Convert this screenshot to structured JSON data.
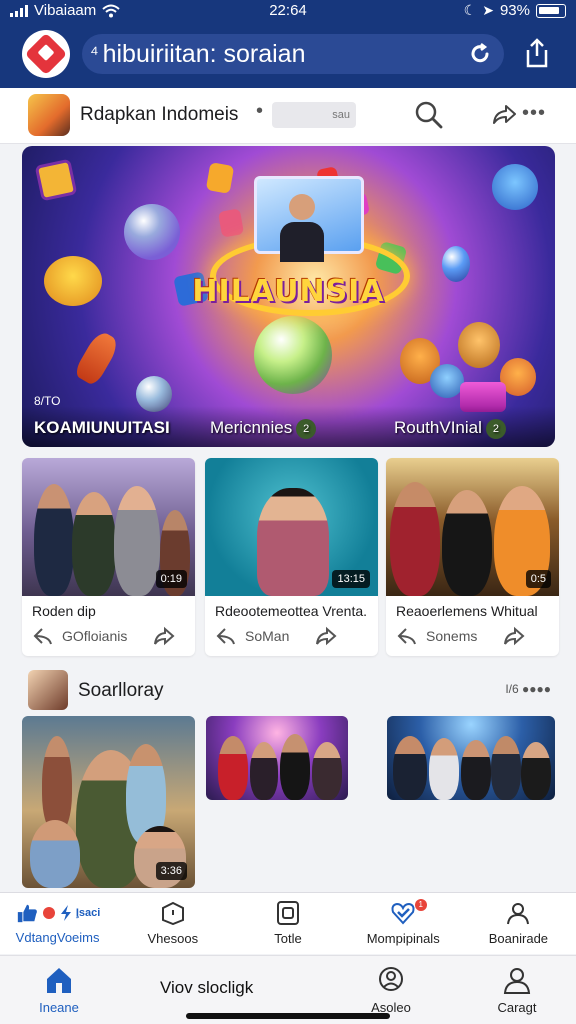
{
  "status_bar": {
    "carrier": "Vibaiaam",
    "time": "22:64",
    "battery": "93%"
  },
  "header": {
    "search_text": "hibuiriitan: soraian"
  },
  "account": {
    "name": "Rdapkan Indomeis",
    "pill": "sau"
  },
  "hero": {
    "title": "HILAUNSIA",
    "retro": "8/TO",
    "labels": [
      {
        "text": "KOAMIUNUITASI",
        "badge": ""
      },
      {
        "text": "Mericnnies",
        "badge": "2"
      },
      {
        "text": "RouthVInial",
        "badge": "2"
      }
    ]
  },
  "cards": [
    {
      "title": "Roden dip",
      "duration": "0:19",
      "comments": "GOfloianis"
    },
    {
      "title": "Rdeootemeottea Vrenta.",
      "duration": "13:15",
      "comments": "SoMan"
    },
    {
      "title": "Reaoerlemens Whitual",
      "duration": "0:5",
      "comments": "Sonems"
    }
  ],
  "section2": {
    "title": "Soarlloray",
    "more": "I/6 ●●●●",
    "video_duration": "3:36"
  },
  "nav1": [
    {
      "label": "VdtangVoeims",
      "badge_text": "I̧saci",
      "active": true,
      "icon": "like-icon"
    },
    {
      "label": "Vhesoos",
      "active": false,
      "icon": "videos-icon"
    },
    {
      "label": "Totle",
      "active": false,
      "icon": "tile-icon"
    },
    {
      "label": "Mompipinals",
      "badge": "1",
      "active": false,
      "icon": "heart-check-icon"
    },
    {
      "label": "Boanirade",
      "active": false,
      "icon": "profile-icon"
    }
  ],
  "nav2": {
    "middle_text": "Viov slocligk",
    "items": [
      {
        "label": "Ineane",
        "active": true,
        "icon": "home-icon"
      },
      {
        "label": "Asoleo",
        "active": false,
        "icon": "clock-user-icon"
      },
      {
        "label": "Caragt",
        "active": false,
        "icon": "person-icon"
      }
    ]
  },
  "colors": {
    "brand": "#17377d",
    "accent": "#1f5fbf",
    "badge": "#e8443a"
  }
}
